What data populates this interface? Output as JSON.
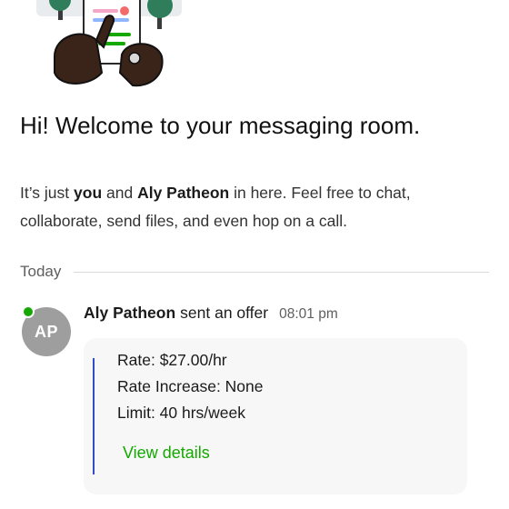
{
  "welcome": {
    "title": "Hi! Welcome to your messaging room.",
    "text_prefix": "It’s just ",
    "you": "you",
    "text_and": " and ",
    "partner": "Aly Patheon",
    "text_suffix": " in here. Feel free to chat, collaborate, send files, and even hop on a call."
  },
  "divider": {
    "label": "Today"
  },
  "message": {
    "avatar_initials": "AP",
    "presence": "online",
    "sender": "Aly Patheon",
    "action": "sent an offer",
    "time": "08:01 pm",
    "offer": {
      "rate": "Rate: $27.00/hr",
      "rate_increase": "Rate Increase: None",
      "limit": "Limit: 40 hrs/week",
      "view_details": "View details"
    }
  },
  "colors": {
    "accent_green": "#14a800",
    "offer_bar": "#2f4fc9",
    "avatar_bg": "#9e9e9e"
  },
  "icons": {
    "hero": "hands-holding-document-illustration"
  }
}
